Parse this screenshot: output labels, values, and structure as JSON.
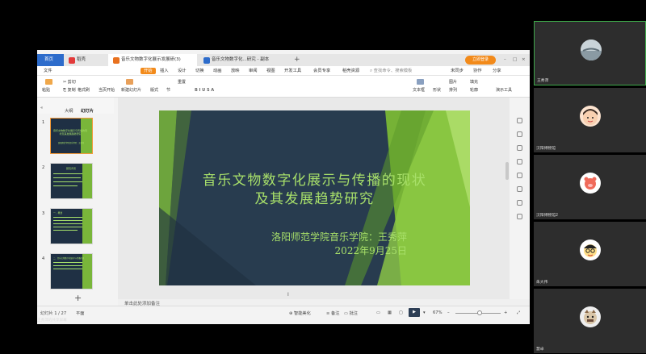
{
  "tabs": {
    "home": "首页",
    "docer": "稻壳",
    "tab1": "音乐文物数字化展示发展研(3)",
    "tab2": "音乐文物数字化...研究 - 副本",
    "login": "立即登录"
  },
  "menu": {
    "file": "文件",
    "start": "开始",
    "insert": "插入",
    "design": "设计",
    "transition": "切换",
    "animation": "动画",
    "show": "放映",
    "review": "审阅",
    "view": "视图",
    "devtools": "开发工具",
    "member": "会员专享",
    "docer_res": "稻壳资源",
    "search_placeholder": "查找命令、搜索模板",
    "sync": "未同步",
    "collab": "协作",
    "share": "分享"
  },
  "ribbon": {
    "cut": "剪切",
    "paste": "粘贴",
    "copy": "复制",
    "format_painter": "格式刷",
    "from_current": "当页开始",
    "new_slide": "新建幻灯片",
    "layout": "版式",
    "section": "节",
    "reset": "重置",
    "textbox": "文本框",
    "shape": "形状",
    "arrange": "排列",
    "outline": "轮廓",
    "picture": "图片",
    "fill": "填充",
    "present_tools": "演示工具"
  },
  "sidebar": {
    "outline_tab": "大纲",
    "slides_tab": "幻灯片",
    "thumb_numbers": [
      "1",
      "2",
      "3",
      "4"
    ],
    "thumb1_title": "音乐文物数字化展示与传播的现状及其发展趋势研究",
    "thumb1_sub": "洛阳师范学院音乐学院：王秀萍",
    "thumb2_title": "研究背景",
    "thumb3_title": "一、概述",
    "thumb4_title": "二、音乐文物数字化展示与传播的现状"
  },
  "slide": {
    "title_line1": "音乐文物数字化展示与传播的现状",
    "title_line2": "及其发展趋势研究",
    "author": "洛阳师范学院音乐学院：王秀萍",
    "date": "2022年9月25日"
  },
  "notes_placeholder": "单击此处添加备注",
  "status": {
    "slide_count": "幻灯片 1 / 27",
    "theme": "平面",
    "beautify": "智能美化",
    "notes": "备注",
    "comment": "批注",
    "zoom": "67%"
  },
  "share_label": "王秀萍的共享屏幕",
  "participants": [
    {
      "name": "王秀萍"
    },
    {
      "name": "汉阳博物馆"
    },
    {
      "name": "汉阳博物馆2"
    },
    {
      "name": "朱大伟"
    },
    {
      "name": "慧卓"
    }
  ],
  "colors": {
    "accent": "#f28a1a",
    "home_tab": "#2d6ccb",
    "slide_bg": "#283c4f",
    "slide_text": "#a8e06a",
    "active_speaker": "#3ea84a"
  }
}
